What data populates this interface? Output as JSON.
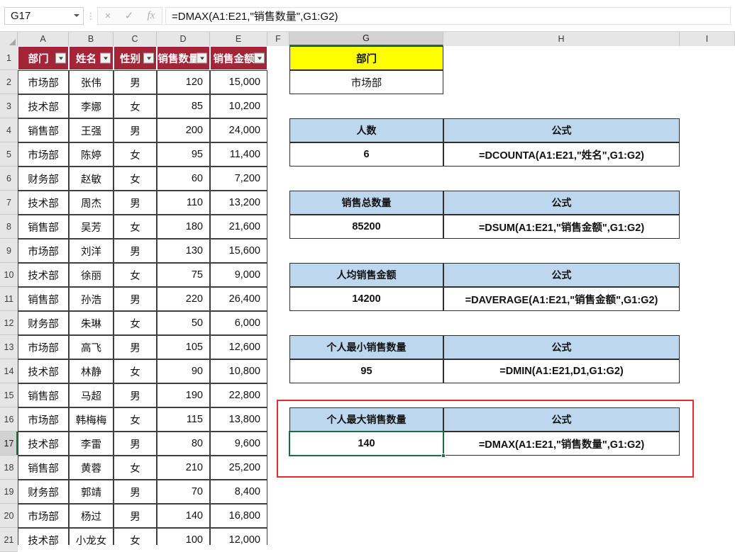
{
  "app": {
    "type": "spreadsheet"
  },
  "formula_bar": {
    "name_box_value": "G17",
    "separator": "⋮",
    "cancel_icon": "×",
    "confirm_icon": "✓",
    "function_icon": "fx",
    "formula": "=DMAX(A1:E21,\"销售数量\",G1:G2)"
  },
  "colors": {
    "table_header_red": "#A32638",
    "criteria_header_yellow": "#FFFF00",
    "formula_header_blue": "#BDD7EE",
    "selection_green": "#1D6B45",
    "annotation_red": "#ED2B2B"
  },
  "column_headers": [
    "A",
    "B",
    "C",
    "D",
    "E",
    "F",
    "G",
    "H",
    "I"
  ],
  "selected_column": "G",
  "row_headers": [
    "1",
    "2",
    "3",
    "4",
    "5",
    "6",
    "7",
    "8",
    "9",
    "10",
    "11",
    "12",
    "13",
    "14",
    "15",
    "16",
    "17",
    "18",
    "19",
    "20",
    "21"
  ],
  "selected_row": "17",
  "table": {
    "headers": [
      "部门",
      "姓名",
      "性别",
      "销售数量",
      "销售金额"
    ],
    "header_display": [
      "部门",
      "姓名",
      "性别",
      "销售数量",
      "销售金额"
    ],
    "rows": [
      [
        "市场部",
        "张伟",
        "男",
        "120",
        "15,000"
      ],
      [
        "技术部",
        "李娜",
        "女",
        "85",
        "10,200"
      ],
      [
        "销售部",
        "王强",
        "男",
        "200",
        "24,000"
      ],
      [
        "市场部",
        "陈婷",
        "女",
        "95",
        "11,400"
      ],
      [
        "财务部",
        "赵敏",
        "女",
        "60",
        "7,200"
      ],
      [
        "技术部",
        "周杰",
        "男",
        "110",
        "13,200"
      ],
      [
        "销售部",
        "吴芳",
        "女",
        "180",
        "21,600"
      ],
      [
        "市场部",
        "刘洋",
        "男",
        "130",
        "15,600"
      ],
      [
        "技术部",
        "徐丽",
        "女",
        "75",
        "9,000"
      ],
      [
        "销售部",
        "孙浩",
        "男",
        "220",
        "26,400"
      ],
      [
        "财务部",
        "朱琳",
        "女",
        "50",
        "6,000"
      ],
      [
        "市场部",
        "高飞",
        "男",
        "105",
        "12,600"
      ],
      [
        "技术部",
        "林静",
        "女",
        "90",
        "10,800"
      ],
      [
        "销售部",
        "马超",
        "男",
        "190",
        "22,800"
      ],
      [
        "市场部",
        "韩梅梅",
        "女",
        "115",
        "13,800"
      ],
      [
        "技术部",
        "李雷",
        "男",
        "80",
        "9,600"
      ],
      [
        "销售部",
        "黄蓉",
        "女",
        "210",
        "25,200"
      ],
      [
        "财务部",
        "郭靖",
        "男",
        "70",
        "8,400"
      ],
      [
        "市场部",
        "杨过",
        "男",
        "140",
        "16,800"
      ],
      [
        "技术部",
        "小龙女",
        "女",
        "100",
        "12,000"
      ]
    ]
  },
  "criteria": {
    "header": "部门",
    "value": "市场部"
  },
  "formula_blocks": [
    {
      "label": "人数",
      "value": "6",
      "formula_header": "公式",
      "formula": "=DCOUNTA(A1:E21,\"姓名\",G1:G2)",
      "highlighted": false
    },
    {
      "label": "销售总数量",
      "value": "85200",
      "formula_header": "公式",
      "formula": "=DSUM(A1:E21,\"销售金额\",G1:G2)",
      "highlighted": false
    },
    {
      "label": "人均销售金额",
      "value": "14200",
      "formula_header": "公式",
      "formula": "=DAVERAGE(A1:E21,\"销售金额\",G1:G2)",
      "highlighted": false
    },
    {
      "label": "个人最小销售数量",
      "value": "95",
      "formula_header": "公式",
      "formula": "=DMIN(A1:E21,D1,G1:G2)",
      "highlighted": false
    },
    {
      "label": "个人最大销售数量",
      "value": "140",
      "formula_header": "公式",
      "formula": "=DMAX(A1:E21,\"销售数量\",G1:G2)",
      "highlighted": true
    }
  ]
}
